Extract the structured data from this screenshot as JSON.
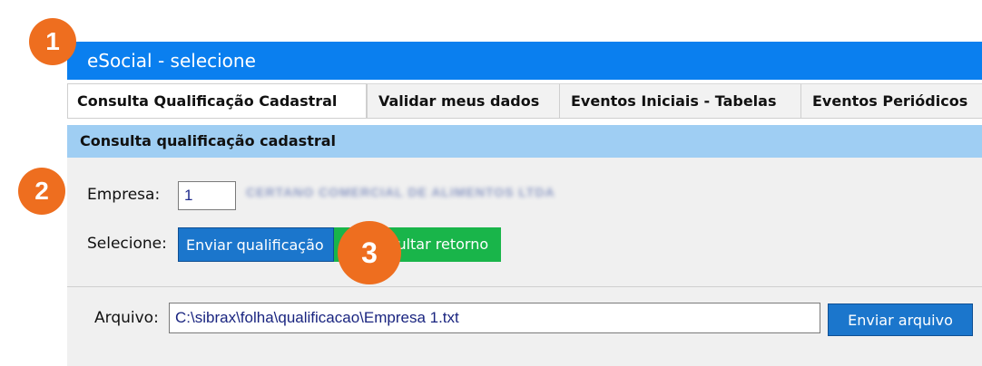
{
  "window": {
    "title": "eSocial  - selecione"
  },
  "tabs": [
    {
      "label": "Consulta Qualificação Cadastral",
      "active": true
    },
    {
      "label": "Validar meus dados",
      "active": false
    },
    {
      "label": "Eventos Iniciais - Tabelas",
      "active": false
    },
    {
      "label": "Eventos Periódicos",
      "active": false
    }
  ],
  "section": {
    "title": "Consulta qualificação cadastral"
  },
  "form": {
    "empresa_label": "Empresa:",
    "empresa_value": "1",
    "empresa_name": "CERTANO COMERCIAL DE ALIMENTOS LTDA",
    "selecione_label": "Selecione:",
    "enviar_qualificacao": "Enviar qualificação",
    "consultar_retorno": "Consultar retorno",
    "arquivo_label": "Arquivo:",
    "arquivo_value": "C:\\sibrax\\folha\\qualificacao\\Empresa 1.txt",
    "enviar_arquivo": "Enviar arquivo"
  },
  "annotations": [
    "1",
    "2",
    "3"
  ],
  "colors": {
    "titlebar": "#0a7fef",
    "section_header": "#9fcef3",
    "panel": "#f0f0f0",
    "button_blue": "#1b76cc",
    "button_green": "#19b54a",
    "badge": "#ee6e1f"
  }
}
